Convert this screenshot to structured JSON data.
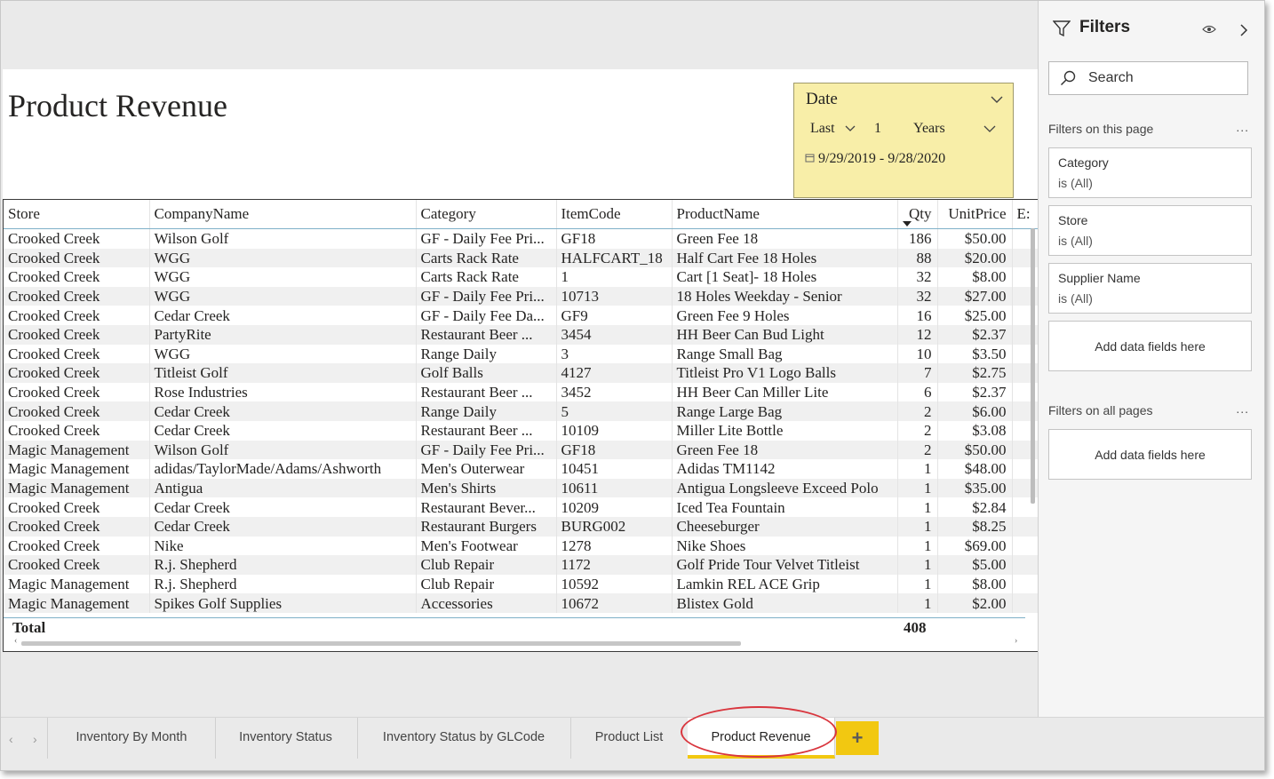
{
  "report": {
    "title": "Product Revenue"
  },
  "slicer": {
    "header": "Date",
    "relative": "Last",
    "count": "1",
    "unit": "Years",
    "range": "9/29/2019 - 9/28/2020"
  },
  "table": {
    "columns": [
      "Store",
      "CompanyName",
      "Category",
      "ItemCode",
      "ProductName",
      "Qty",
      "UnitPrice",
      "E:"
    ],
    "rows": [
      [
        "Crooked Creek",
        "Wilson Golf",
        "GF - Daily Fee Pri...",
        "GF18",
        "Green Fee 18",
        "186",
        "$50.00"
      ],
      [
        "Crooked Creek",
        "WGG",
        "Carts Rack Rate",
        "HALFCART_18",
        "Half Cart Fee 18 Holes",
        "88",
        "$20.00"
      ],
      [
        "Crooked Creek",
        "WGG",
        "Carts Rack Rate",
        "1",
        "Cart [1 Seat]- 18 Holes",
        "32",
        "$8.00"
      ],
      [
        "Crooked Creek",
        "WGG",
        "GF - Daily Fee Pri...",
        "10713",
        "18 Holes Weekday - Senior",
        "32",
        "$27.00"
      ],
      [
        "Crooked Creek",
        "Cedar Creek",
        "GF - Daily Fee Da...",
        "GF9",
        "Green Fee 9 Holes",
        "16",
        "$25.00"
      ],
      [
        "Crooked Creek",
        "PartyRite",
        "Restaurant Beer ...",
        "3454",
        "HH Beer Can Bud Light",
        "12",
        "$2.37"
      ],
      [
        "Crooked Creek",
        "WGG",
        "Range Daily",
        "3",
        "Range Small Bag",
        "10",
        "$3.50"
      ],
      [
        "Crooked Creek",
        "Titleist Golf",
        "Golf Balls",
        "4127",
        "Titleist Pro V1 Logo Balls",
        "7",
        "$2.75"
      ],
      [
        "Crooked Creek",
        "Rose Industries",
        "Restaurant Beer ...",
        "3452",
        "HH Beer Can Miller Lite",
        "6",
        "$2.37"
      ],
      [
        "Crooked Creek",
        "Cedar Creek",
        "Range Daily",
        "5",
        "Range Large Bag",
        "2",
        "$6.00"
      ],
      [
        "Crooked Creek",
        "Cedar Creek",
        "Restaurant Beer ...",
        "10109",
        "Miller Lite Bottle",
        "2",
        "$3.08"
      ],
      [
        "Magic Management",
        "Wilson Golf",
        "GF - Daily Fee Pri...",
        "GF18",
        "Green Fee 18",
        "2",
        "$50.00"
      ],
      [
        "Magic Management",
        "adidas/TaylorMade/Adams/Ashworth",
        "Men's Outerwear",
        "10451",
        "Adidas TM1142",
        "1",
        "$48.00"
      ],
      [
        "Magic Management",
        "Antigua",
        "Men's Shirts",
        "10611",
        "Antigua Longsleeve Exceed Polo",
        "1",
        "$35.00"
      ],
      [
        "Crooked Creek",
        "Cedar Creek",
        "Restaurant Bever...",
        "10209",
        "Iced Tea Fountain",
        "1",
        "$2.84"
      ],
      [
        "Crooked Creek",
        "Cedar Creek",
        "Restaurant Burgers",
        "BURG002",
        "Cheeseburger",
        "1",
        "$8.25"
      ],
      [
        "Crooked Creek",
        "Nike",
        "Men's Footwear",
        "1278",
        "Nike Shoes",
        "1",
        "$69.00"
      ],
      [
        "Crooked Creek",
        "R.j. Shepherd",
        "Club Repair",
        "1172",
        "Golf Pride Tour Velvet Titleist",
        "1",
        "$5.00"
      ],
      [
        "Magic Management",
        "R.j. Shepherd",
        "Club Repair",
        "10592",
        "Lamkin REL ACE Grip",
        "1",
        "$8.00"
      ],
      [
        "Magic Management",
        "Spikes Golf Supplies",
        "Accessories",
        "10672",
        "Blistex Gold",
        "1",
        "$2.00"
      ]
    ],
    "total_label": "Total",
    "total_qty": "408"
  },
  "filters": {
    "title": "Filters",
    "search_label": "Search",
    "page_section": "Filters on this page",
    "all_section": "Filters on all pages",
    "more": "...",
    "cards": [
      {
        "field": "Category",
        "value": "is (All)"
      },
      {
        "field": "Store",
        "value": "is (All)"
      },
      {
        "field": "Supplier Name",
        "value": "is (All)"
      }
    ],
    "add_fields": "Add data fields here"
  },
  "tabs": [
    {
      "label": "Inventory By Month",
      "active": false
    },
    {
      "label": "Inventory Status",
      "active": false
    },
    {
      "label": "Inventory Status by GLCode",
      "active": false
    },
    {
      "label": "Product List",
      "active": false
    },
    {
      "label": "Product Revenue",
      "active": true
    }
  ],
  "add_tab": "+",
  "colors": {
    "slicer_bg": "#f8eea8",
    "accent_yellow": "#f2c811",
    "annotation_red": "#d9363e"
  }
}
